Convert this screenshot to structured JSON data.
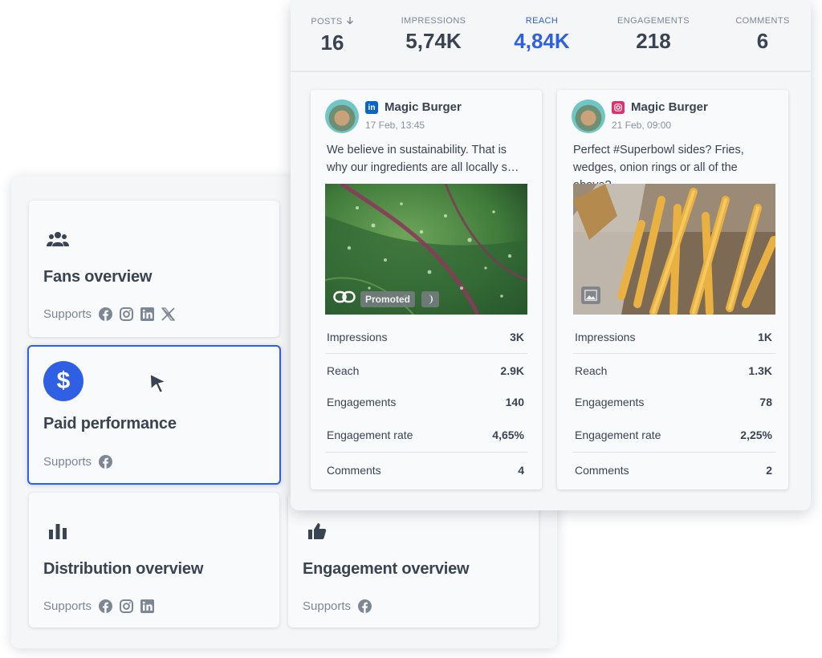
{
  "stats": [
    {
      "label": "POSTS",
      "value": "16",
      "sort_icon": "arrow-down-icon"
    },
    {
      "label": "IMPRESSIONS",
      "value": "5,74K"
    },
    {
      "label": "REACH",
      "value": "4,84K",
      "active": true
    },
    {
      "label": "ENGAGEMENTS",
      "value": "218"
    },
    {
      "label": "COMMENTS",
      "value": "6"
    }
  ],
  "posts": [
    {
      "network": "linkedin",
      "author": "Magic Burger",
      "time": "17 Feb, 13:45",
      "text": "We believe in sustainability. That is why our ingredients are all locally s…",
      "image": "leaf-photo",
      "badge": "Promoted",
      "metrics": [
        {
          "label": "Impressions",
          "value": "3K"
        },
        {
          "label": "Reach",
          "value": "2.9K"
        },
        {
          "label": "Engagements",
          "value": "140"
        },
        {
          "label": "Engagement rate",
          "value": "4,65%"
        },
        {
          "label": "Comments",
          "value": "4"
        }
      ]
    },
    {
      "network": "instagram",
      "author": "Magic Burger",
      "time": "21 Feb, 09:00",
      "text": "Perfect #Superbowl sides? Fries, wedges, onion rings or all of the above?",
      "image": "fries-photo",
      "metrics": [
        {
          "label": "Impressions",
          "value": "1K"
        },
        {
          "label": "Reach",
          "value": "1.3K"
        },
        {
          "label": "Engagements",
          "value": "78"
        },
        {
          "label": "Engagement rate",
          "value": "2,25%"
        },
        {
          "label": "Comments",
          "value": "2"
        }
      ]
    }
  ],
  "cards": [
    {
      "title": "Fans overview",
      "icon": "users-icon",
      "supports_label": "Supports",
      "networks": [
        "facebook",
        "instagram",
        "linkedin",
        "x"
      ]
    },
    {
      "title": "Paid performance",
      "icon": "dollar-icon",
      "supports_label": "Supports",
      "networks": [
        "facebook"
      ],
      "selected": true
    },
    {
      "title": "Distribution overview",
      "icon": "bar-chart-icon",
      "supports_label": "Supports",
      "networks": [
        "facebook",
        "instagram",
        "linkedin"
      ]
    },
    {
      "title": "Engagement overview",
      "icon": "thumbs-up-icon",
      "supports_label": "Supports",
      "networks": [
        "facebook"
      ]
    }
  ],
  "colors": {
    "accent": "#2f5fe3",
    "linkedin": "#0a66c2",
    "instagram": "#e1306c",
    "text": "#3a4352",
    "muted": "#7d8694"
  }
}
